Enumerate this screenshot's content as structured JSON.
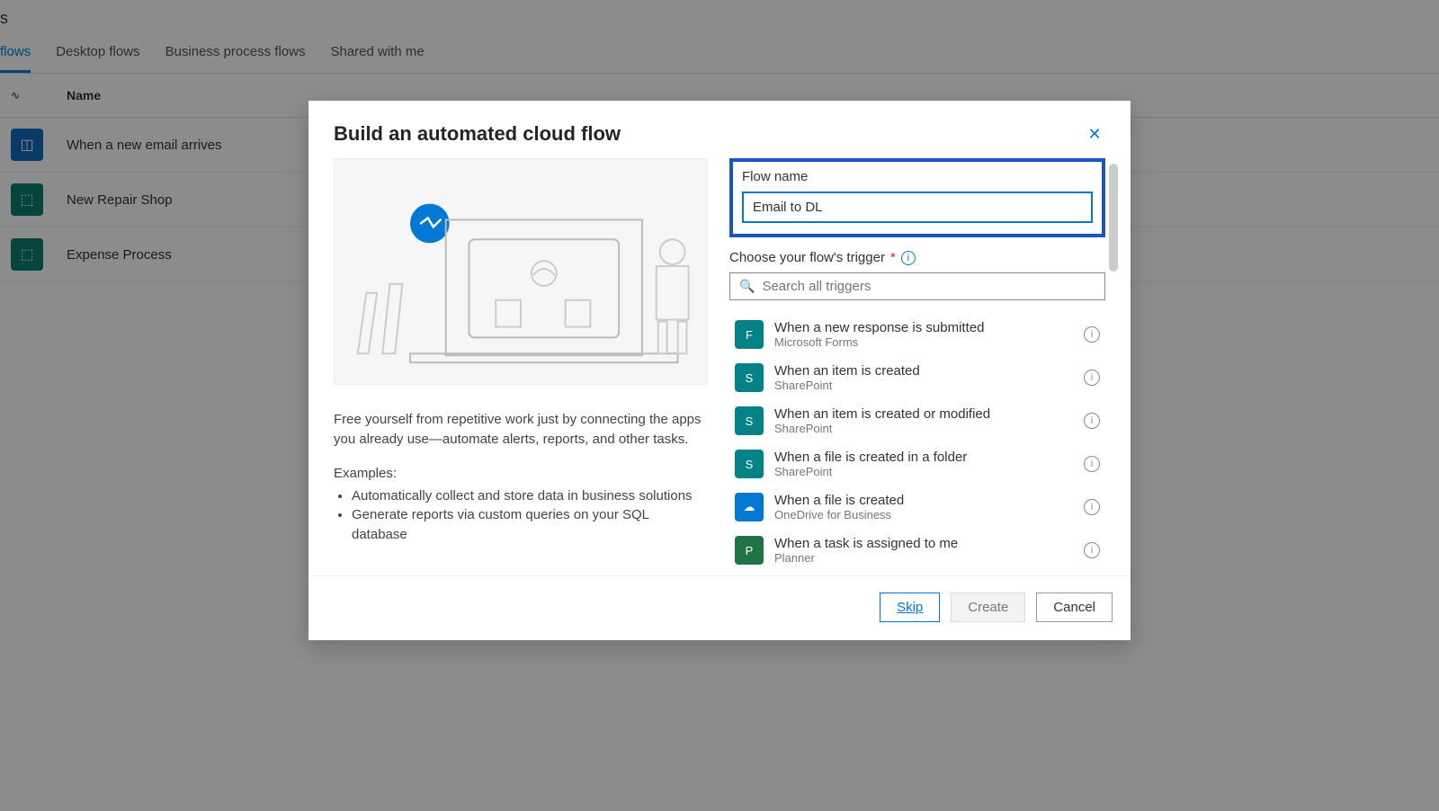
{
  "page": {
    "title_suffix": "s"
  },
  "tabs": [
    "flows",
    "Desktop flows",
    "Business process flows",
    "Shared with me"
  ],
  "table": {
    "header_name": "Name",
    "rows": [
      {
        "name": "When a new email arrives",
        "color": "blue"
      },
      {
        "name": "New Repair Shop",
        "color": "teal"
      },
      {
        "name": "Expense Process",
        "color": "teal"
      }
    ]
  },
  "modal": {
    "title": "Build an automated cloud flow",
    "flow_name_label": "Flow name",
    "flow_name_value": "Email to DL",
    "trigger_label": "Choose your flow's trigger",
    "search_placeholder": "Search all triggers",
    "description": "Free yourself from repetitive work just by connecting the apps you already use—automate alerts, reports, and other tasks.",
    "examples_label": "Examples:",
    "examples": [
      "Automatically collect and store data in business solutions",
      "Generate reports via custom queries on your SQL database"
    ],
    "triggers": [
      {
        "title": "When a new response is submitted",
        "sub": "Microsoft Forms",
        "color": "teal"
      },
      {
        "title": "When an item is created",
        "sub": "SharePoint",
        "color": "teal"
      },
      {
        "title": "When an item is created or modified",
        "sub": "SharePoint",
        "color": "teal"
      },
      {
        "title": "When a file is created in a folder",
        "sub": "SharePoint",
        "color": "teal"
      },
      {
        "title": "When a file is created",
        "sub": "OneDrive for Business",
        "color": "blue"
      },
      {
        "title": "When a task is assigned to me",
        "sub": "Planner",
        "color": "green"
      }
    ],
    "buttons": {
      "skip": "Skip",
      "create": "Create",
      "cancel": "Cancel"
    }
  }
}
